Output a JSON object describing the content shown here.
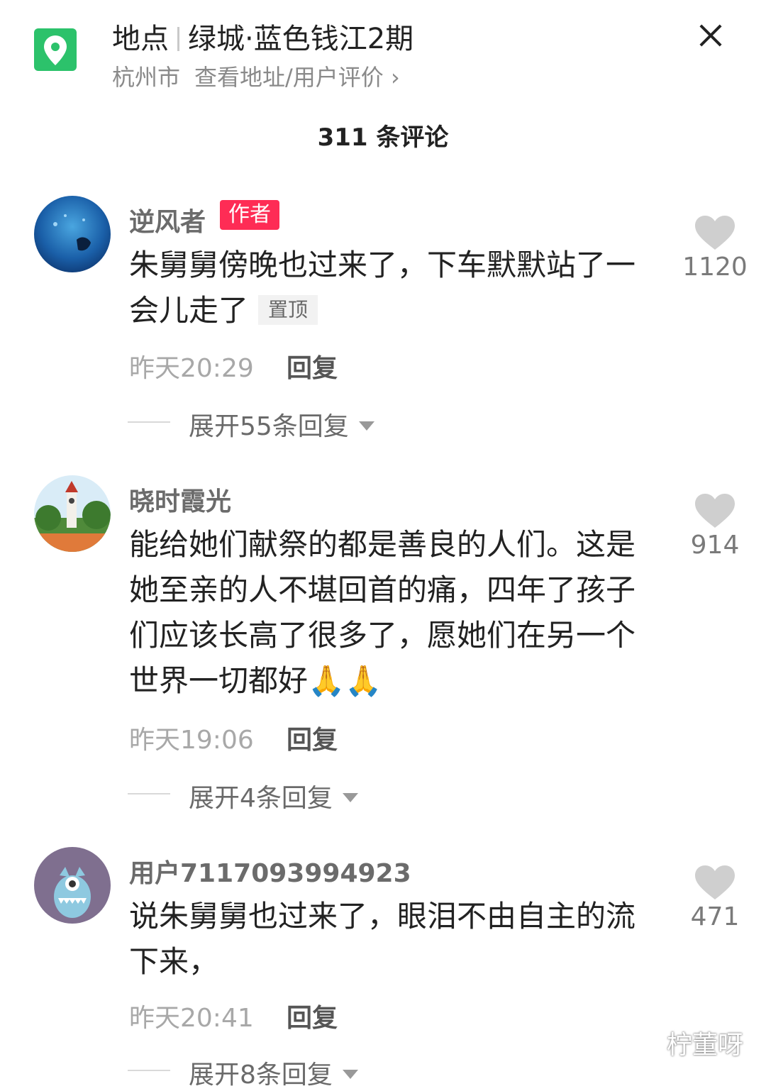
{
  "location": {
    "label": "地点",
    "name": "绿城·蓝色钱江2期",
    "city": "杭州市",
    "link": "查看地址/用户评价 ›"
  },
  "comments_count": "311 条评论",
  "comments": [
    {
      "username": "逆风者",
      "badge": "作者",
      "text": "朱舅舅傍晚也过来了，下车默默站了一会儿走了",
      "pinned": "置顶",
      "time": "昨天20:29",
      "reply": "回复",
      "expand": "展开55条回复",
      "likes": "1120"
    },
    {
      "username": "晓时霞光",
      "text": "能给她们献祭的都是善良的人们。这是她至亲的人不堪回首的痛，四年了孩子们应该长高了很多了，愿她们在另一个世界一切都好🙏🙏",
      "time": "昨天19:06",
      "reply": "回复",
      "expand": "展开4条回复",
      "likes": "914"
    },
    {
      "username": "用户7117093994923",
      "text": "说朱舅舅也过来了，眼泪不由自主的流下来，",
      "time": "昨天20:41",
      "reply": "回复",
      "expand": "展开8条回复",
      "likes": "471"
    }
  ],
  "watermark": "柠董呀",
  "colors": {
    "accent_green": "#2cc26b",
    "author_badge": "#fe2c55"
  }
}
